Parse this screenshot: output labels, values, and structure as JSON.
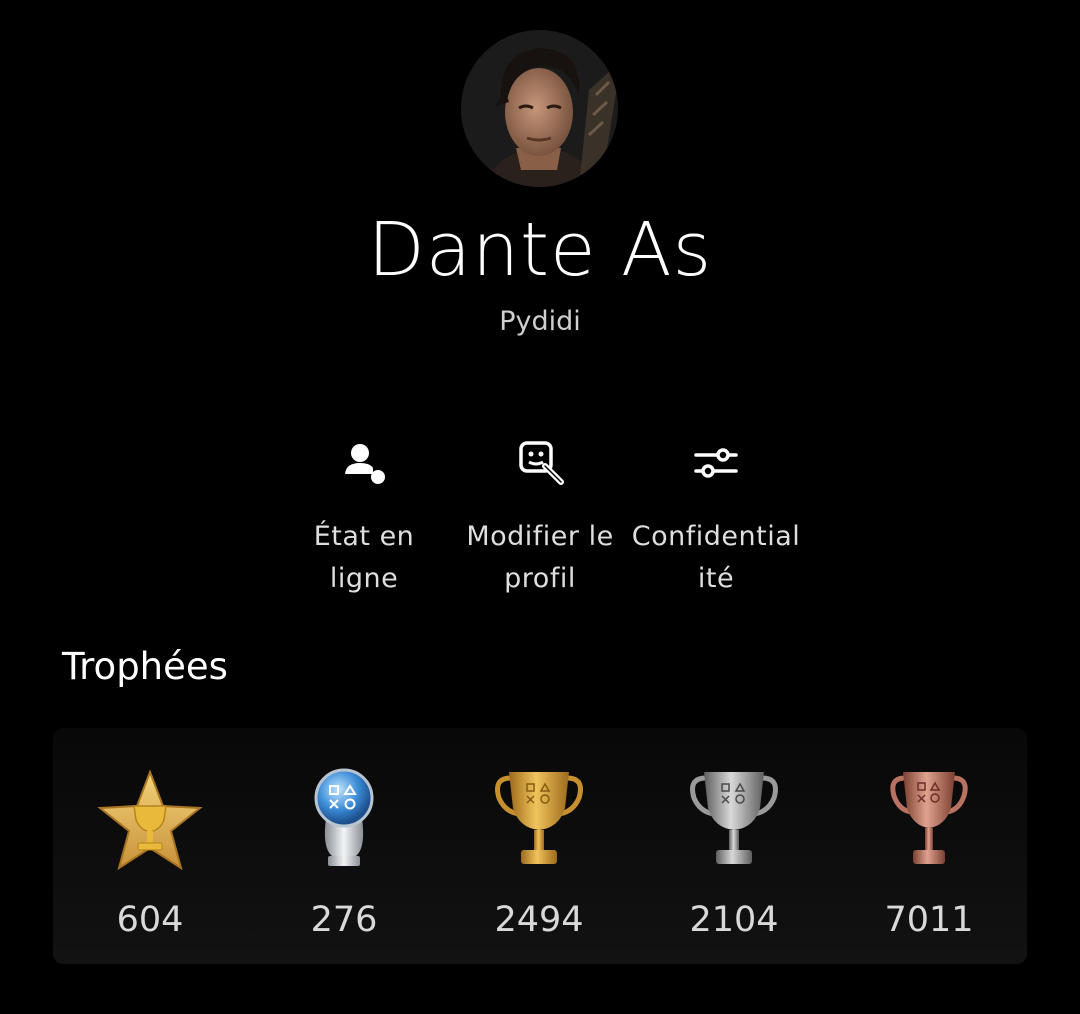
{
  "profile": {
    "display_name": "Dante As",
    "online_id": "Pydidi"
  },
  "actions": [
    {
      "label_line1": "État en",
      "label_line2": "ligne",
      "icon": "online-status-icon"
    },
    {
      "label_line1": "Modifier le",
      "label_line2": "profil",
      "icon": "edit-profile-icon"
    },
    {
      "label_line1": "Confidential",
      "label_line2": "ité",
      "icon": "privacy-sliders-icon"
    }
  ],
  "trophies": {
    "title": "Trophées",
    "items": [
      {
        "type": "level",
        "count": "604",
        "icon": "trophy-level-star-icon"
      },
      {
        "type": "platinum",
        "count": "276",
        "icon": "platinum-trophy-icon"
      },
      {
        "type": "gold",
        "count": "2494",
        "icon": "gold-trophy-icon"
      },
      {
        "type": "silver",
        "count": "2104",
        "icon": "silver-trophy-icon"
      },
      {
        "type": "bronze",
        "count": "7011",
        "icon": "bronze-trophy-icon"
      }
    ]
  },
  "colors": {
    "background": "#000000",
    "card": "#111111",
    "gold": "#d9a63a",
    "silver": "#a9a9a9",
    "bronze": "#b87262",
    "platinum": "#3a8bd6"
  }
}
